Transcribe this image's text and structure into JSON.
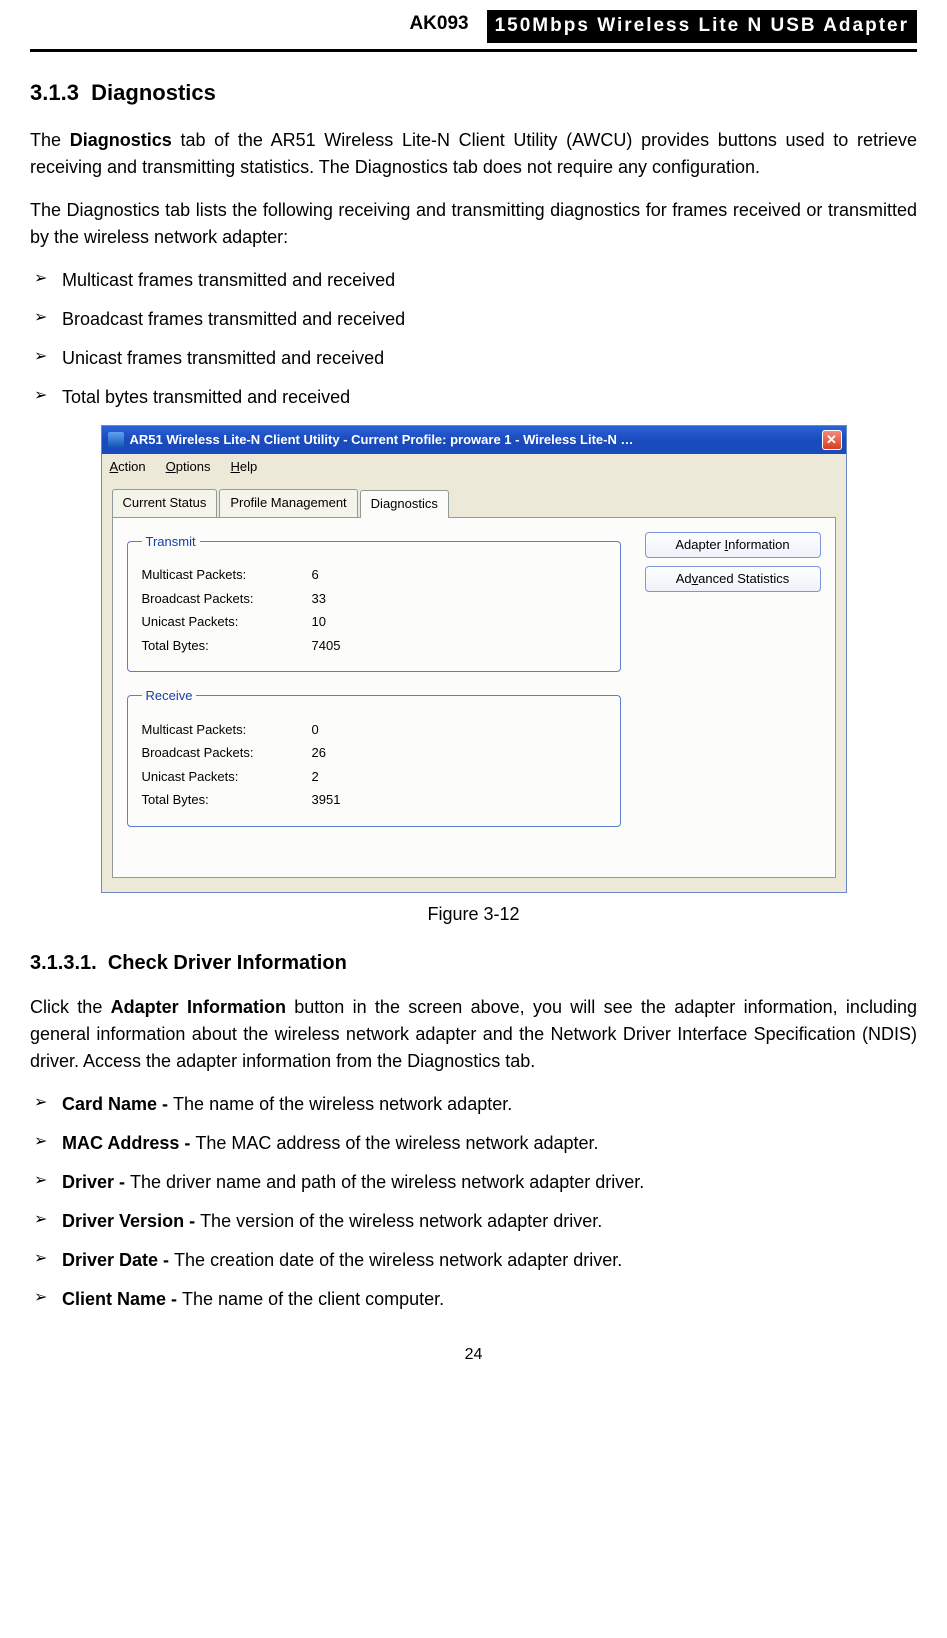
{
  "header": {
    "model": "AK093",
    "title": "150Mbps Wireless Lite N USB Adapter"
  },
  "section": {
    "number": "3.1.3",
    "title": "Diagnostics"
  },
  "para1_a": "The ",
  "para1_bold": "Diagnostics",
  "para1_b": " tab of the AR51 Wireless Lite-N Client Utility (AWCU) provides buttons used to retrieve receiving and transmitting statistics. The Diagnostics tab does not require any configuration.",
  "para2": "The Diagnostics tab lists the following receiving and transmitting diagnostics for frames received or transmitted by the wireless network adapter:",
  "bullets1": [
    "Multicast frames transmitted and received",
    "Broadcast frames transmitted and received",
    "Unicast frames transmitted and received",
    "Total bytes transmitted and received"
  ],
  "screenshot": {
    "title": "AR51 Wireless Lite-N Client Utility - Current Profile: proware 1 - Wireless Lite-N …",
    "menus": {
      "action": "Action",
      "options": "Options",
      "help": "Help"
    },
    "tabs": {
      "current": "Current Status",
      "profile": "Profile Management",
      "diag": "Diagnostics"
    },
    "buttons": {
      "adapter_info": "Adapter Information",
      "adv_stats": "Advanced Statistics"
    },
    "transmit": {
      "legend": "Transmit",
      "rows": [
        {
          "label": "Multicast Packets:",
          "value": "6"
        },
        {
          "label": "Broadcast Packets:",
          "value": "33"
        },
        {
          "label": "Unicast Packets:",
          "value": "10"
        },
        {
          "label": "Total Bytes:",
          "value": "7405"
        }
      ]
    },
    "receive": {
      "legend": "Receive",
      "rows": [
        {
          "label": "Multicast Packets:",
          "value": "0"
        },
        {
          "label": "Broadcast Packets:",
          "value": "26"
        },
        {
          "label": "Unicast Packets:",
          "value": "2"
        },
        {
          "label": "Total Bytes:",
          "value": "3951"
        }
      ]
    }
  },
  "figure_caption": "Figure 3-12",
  "subsection": {
    "number": "3.1.3.1.",
    "title": "Check Driver Information"
  },
  "para3_a": "Click the ",
  "para3_bold": "Adapter Information",
  "para3_b": " button in the screen above, you will see the adapter information, including general information about the wireless network adapter and the Network Driver Interface Specification (NDIS) driver. Access the adapter information from the Diagnostics tab.",
  "bullets2": [
    {
      "term": "Card Name - ",
      "desc": "The name of the wireless network adapter."
    },
    {
      "term": "MAC Address - ",
      "desc": "The MAC address of the wireless network adapter."
    },
    {
      "term": "Driver - ",
      "desc": "The driver name and path of the wireless network adapter driver."
    },
    {
      "term": "Driver Version - ",
      "desc": "The version of the wireless network adapter driver."
    },
    {
      "term": "Driver Date - ",
      "desc": "The creation date of the wireless network adapter driver."
    },
    {
      "term": "Client Name - ",
      "desc": "The name of the client computer."
    }
  ],
  "page_number": "24"
}
